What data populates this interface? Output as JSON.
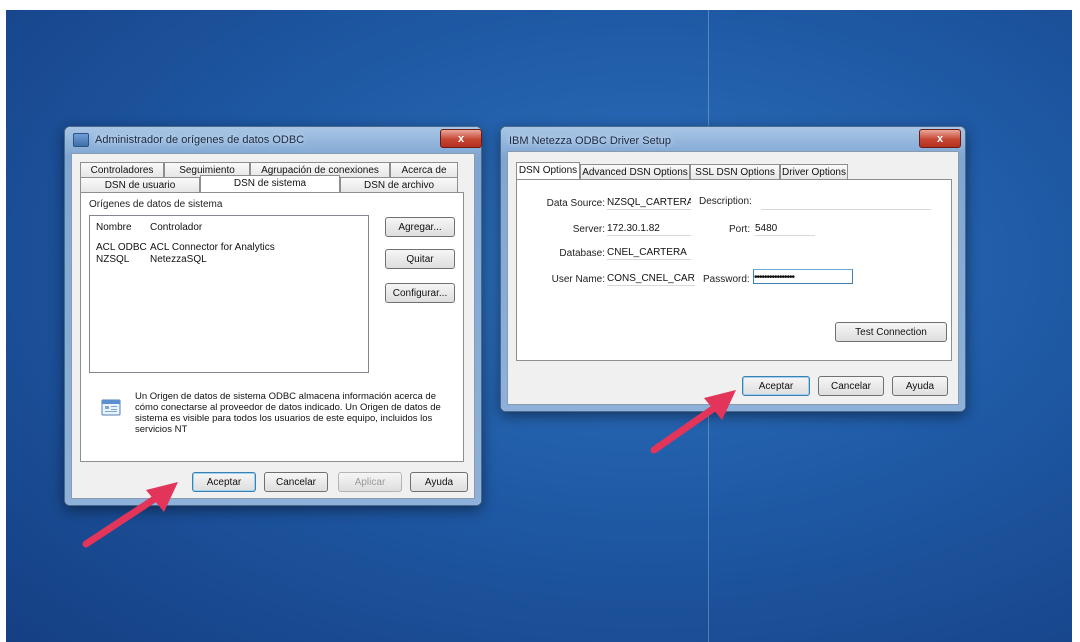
{
  "colors": {
    "desktop": "#1f5aa6",
    "arrow": "#e3345a"
  },
  "odbc": {
    "title": "Administrador de orígenes de datos ODBC",
    "close_label": "x",
    "tabs_top": [
      "Controladores",
      "Seguimiento",
      "Agrupación de conexiones",
      "Acerca de"
    ],
    "tabs_bottom": [
      "DSN de usuario",
      "DSN de sistema",
      "DSN de archivo"
    ],
    "group_label": "Orígenes de datos de sistema",
    "list_header": {
      "name": "Nombre",
      "driver": "Controlador"
    },
    "list_rows": [
      {
        "name": "ACL ODBC",
        "driver": "ACL Connector for Analytics"
      },
      {
        "name": "NZSQL",
        "driver": "NetezzaSQL"
      }
    ],
    "side_buttons": {
      "add": "Agregar...",
      "remove": "Quitar",
      "configure": "Configurar..."
    },
    "info_text": "Un Origen de datos de sistema ODBC almacena información acerca de cómo conectarse al proveedor de datos indicado. Un Origen de datos de sistema es visible para todos los usuarios de este equipo, incluidos los servicios NT",
    "info_icon": "database-info-icon",
    "buttons": {
      "ok": "Aceptar",
      "cancel": "Cancelar",
      "apply": "Aplicar",
      "help": "Ayuda"
    }
  },
  "netezza": {
    "title": "IBM Netezza ODBC Driver Setup",
    "close_label": "x",
    "tabs": [
      "DSN Options",
      "Advanced DSN Options",
      "SSL DSN Options",
      "Driver Options"
    ],
    "fields": {
      "data_source_label": "Data Source:",
      "data_source_value": "NZSQL_CARTERA",
      "description_label": "Description:",
      "description_value": "",
      "server_label": "Server:",
      "server_value": "172.30.1.82",
      "port_label": "Port:",
      "port_value": "5480",
      "database_label": "Database:",
      "database_value": "CNEL_CARTERA",
      "user_label": "User Name:",
      "user_value": "CONS_CNEL_CARTI",
      "password_label": "Password:",
      "password_value": "••••••••••••••••"
    },
    "test_button": "Test Connection",
    "buttons": {
      "ok": "Aceptar",
      "cancel": "Cancelar",
      "help": "Ayuda"
    }
  }
}
